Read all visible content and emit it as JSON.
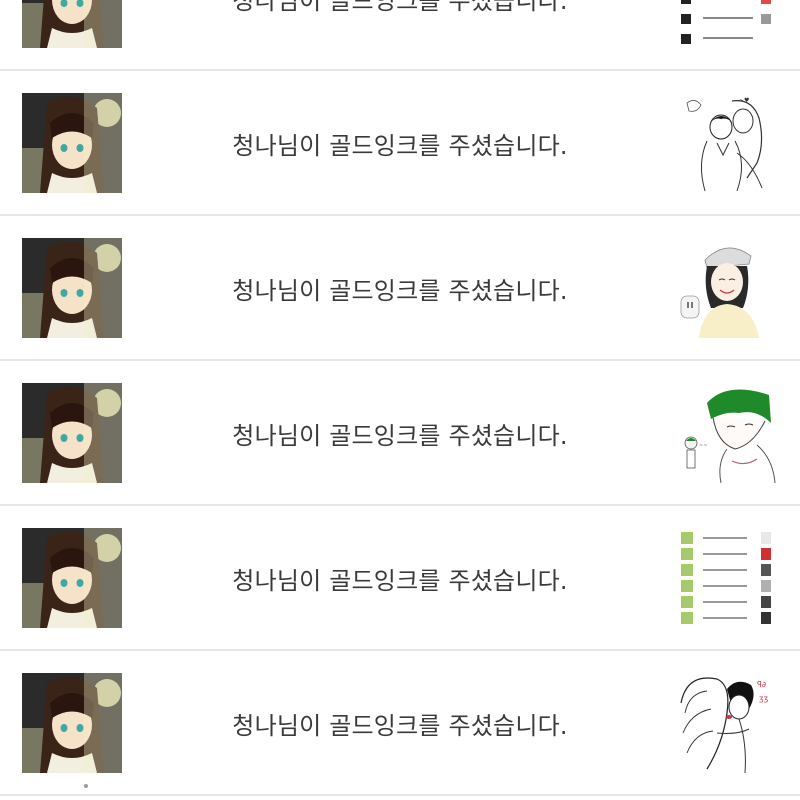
{
  "notifications": [
    {
      "message": "청나님이 골드잉크를 주셨습니다.",
      "avatar_icon": "anime-girl-avatar",
      "thumbnail_icon": "notification-list-thumbnail"
    },
    {
      "message": "청나님이 골드잉크를 주셨습니다.",
      "avatar_icon": "anime-girl-avatar",
      "thumbnail_icon": "couple-sketch-thumbnail"
    },
    {
      "message": "청나님이 골드잉크를 주셨습니다.",
      "avatar_icon": "anime-girl-avatar",
      "thumbnail_icon": "smiling-girl-beanie-thumbnail"
    },
    {
      "message": "청나님이 골드잉크를 주셨습니다.",
      "avatar_icon": "anime-girl-avatar",
      "thumbnail_icon": "green-hair-boy-thumbnail"
    },
    {
      "message": "청나님이 골드잉크를 주셨습니다.",
      "avatar_icon": "anime-girl-avatar",
      "thumbnail_icon": "notification-list-thumbnail"
    },
    {
      "message": "청나님이 골드잉크를 주셨습니다.",
      "avatar_icon": "anime-girl-avatar",
      "thumbnail_icon": "embracing-couple-sketch-thumbnail"
    }
  ]
}
